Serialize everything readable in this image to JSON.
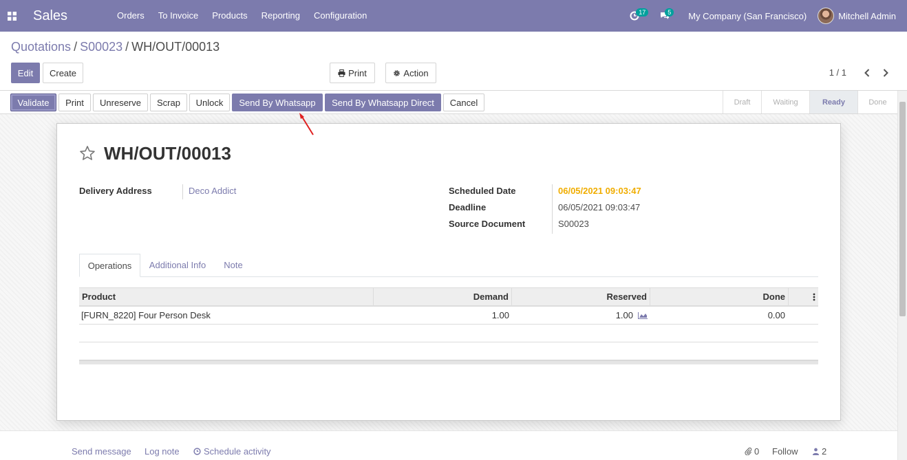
{
  "navbar": {
    "app_name": "Sales",
    "menu": [
      "Orders",
      "To Invoice",
      "Products",
      "Reporting",
      "Configuration"
    ],
    "activity_count": "17",
    "message_count": "5",
    "company": "My Company (San Francisco)",
    "user": "Mitchell Admin",
    "color": "#7c7bad"
  },
  "breadcrumb": {
    "root": "Quotations",
    "parent": "S00023",
    "current": "WH/OUT/00013",
    "separator": "/"
  },
  "control": {
    "edit": "Edit",
    "create": "Create",
    "print": "Print",
    "action": "Action",
    "pager": "1 / 1"
  },
  "statusbar": {
    "buttons": [
      "Validate",
      "Print",
      "Unreserve",
      "Scrap",
      "Unlock",
      "Send By Whatsapp",
      "Send By Whatsapp Direct",
      "Cancel"
    ],
    "stages": [
      "Draft",
      "Waiting",
      "Ready",
      "Done"
    ],
    "current_stage": "Ready"
  },
  "record": {
    "name": "WH/OUT/00013",
    "delivery_address_label": "Delivery Address",
    "delivery_address": "Deco Addict",
    "scheduled_date_label": "Scheduled Date",
    "scheduled_date": "06/05/2021 09:03:47",
    "deadline_label": "Deadline",
    "deadline": "06/05/2021 09:03:47",
    "source_document_label": "Source Document",
    "source_document": "S00023"
  },
  "tabs": [
    "Operations",
    "Additional Info",
    "Note"
  ],
  "operations": {
    "columns": [
      "Product",
      "Demand",
      "Reserved",
      "Done"
    ],
    "rows": [
      {
        "product": "[FURN_8220] Four Person Desk",
        "demand": "1.00",
        "reserved": "1.00",
        "done": "0.00"
      }
    ]
  },
  "chatter": {
    "send_message": "Send message",
    "log_note": "Log note",
    "schedule_activity": "Schedule activity",
    "attachments": "0",
    "follow": "Follow",
    "followers": "2"
  }
}
